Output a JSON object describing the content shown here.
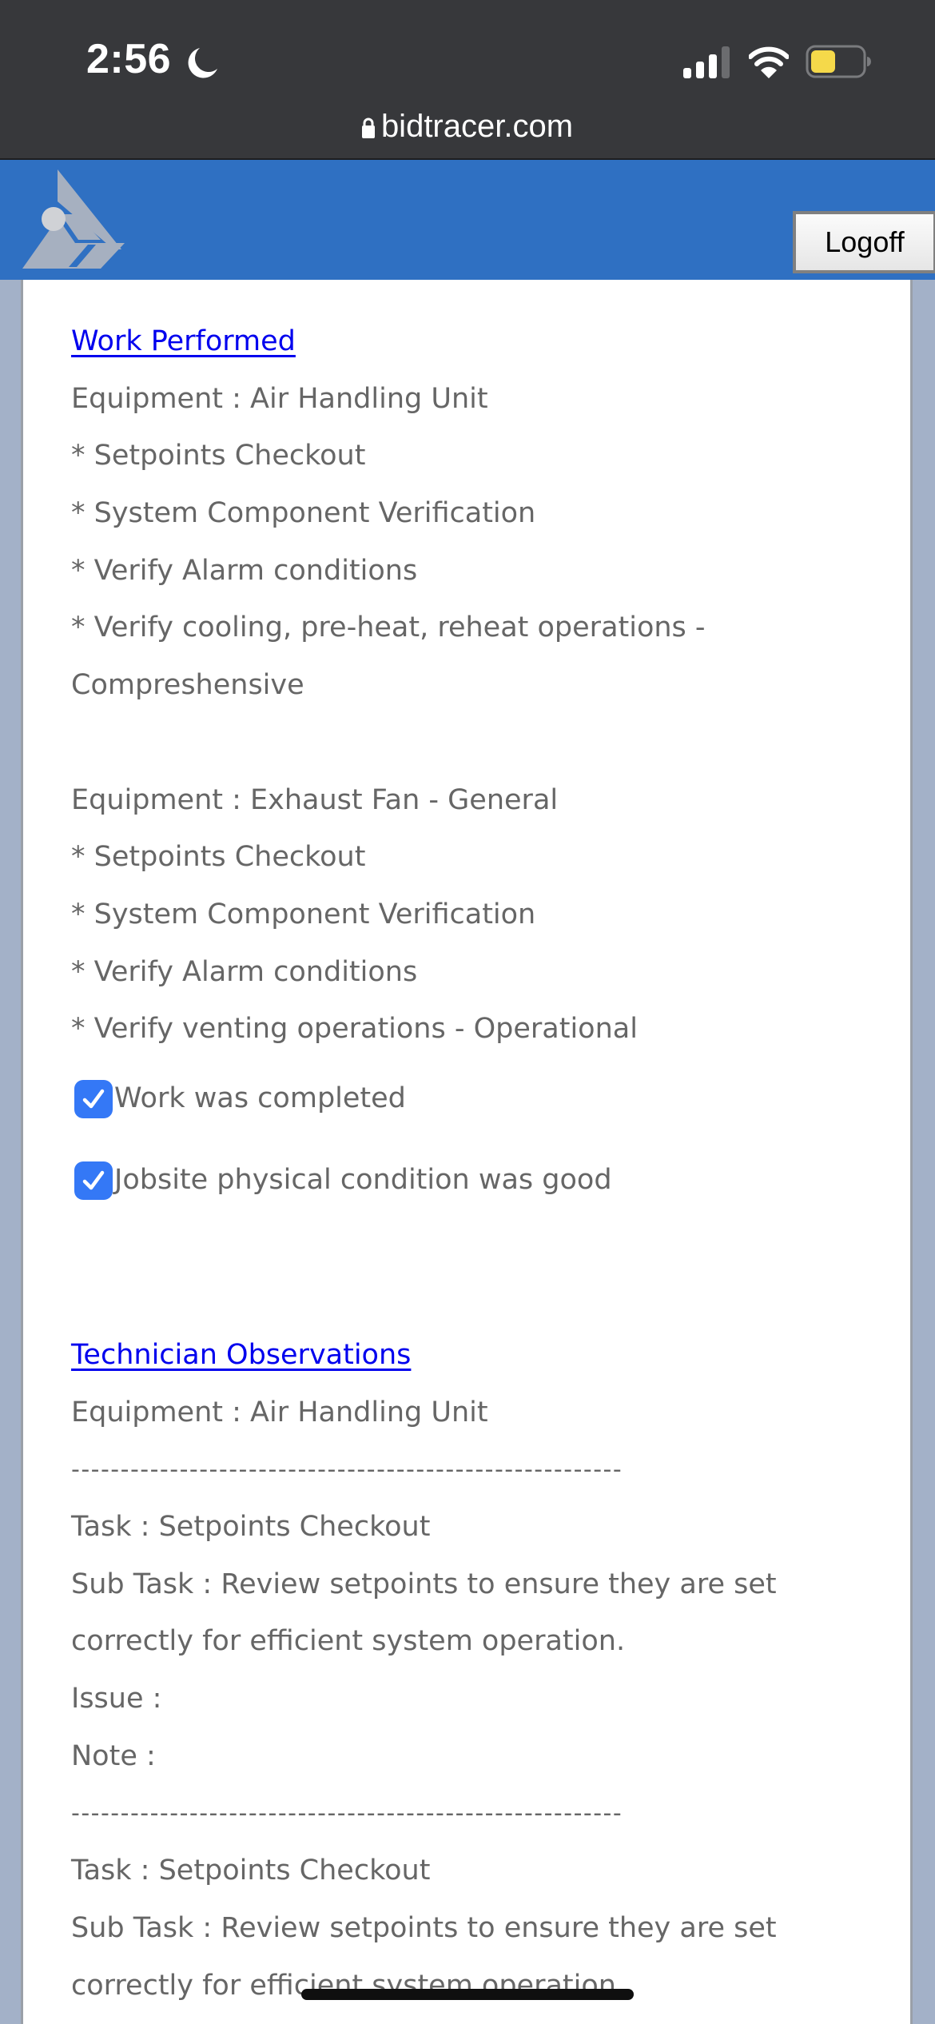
{
  "status_bar": {
    "time": "2:56",
    "focus_mode_icon": "moon-icon",
    "signal_bars": 3,
    "signal_bars_total": 4,
    "wifi_icon": "wifi-icon",
    "battery_percent": 45,
    "battery_color": "#f5d94a"
  },
  "browser": {
    "lock_icon": "lock-icon",
    "url": "bidtracer.com"
  },
  "header": {
    "logo_icon": "bidtracer-logo-icon",
    "background_color": "#2f70c2",
    "logoff_label": "Logoff"
  },
  "work_performed": {
    "title": "Work Performed",
    "groups": [
      {
        "equipment": "Equipment : Air Handling Unit",
        "items": [
          "* Setpoints Checkout",
          "* System Component Verification",
          "* Verify Alarm conditions",
          "* Verify cooling, pre-heat, reheat operations -",
          "Compreshensive"
        ]
      },
      {
        "equipment": "Equipment : Exhaust Fan - General",
        "items": [
          "* Setpoints Checkout",
          "* System Component Verification",
          "* Verify Alarm conditions",
          "* Verify venting operations - Operational"
        ]
      }
    ],
    "checkboxes": [
      {
        "label": "Work was completed",
        "checked": true
      },
      {
        "label": "Jobsite physical condition was good",
        "checked": true
      }
    ],
    "checkbox_color": "#3478f6"
  },
  "technician_observations": {
    "title": "Technician Observations",
    "equipment": "Equipment : Air Handling Unit",
    "separator": "--------------------------------------------------------",
    "entries": [
      {
        "task": "Task : Setpoints Checkout",
        "sub_task_line1": "Sub Task : Review setpoints to ensure they are set",
        "sub_task_line2": "correctly for efficient system operation.",
        "issue": "Issue :",
        "note": "Note :"
      },
      {
        "task": "Task : Setpoints Checkout",
        "sub_task_line1": "Sub Task : Review setpoints to ensure they are set",
        "sub_task_line2": "correctly for efficient system operation."
      }
    ]
  },
  "colors": {
    "link": "#0000ee",
    "body_text": "#666666",
    "page_background": "#a3b1c8"
  }
}
